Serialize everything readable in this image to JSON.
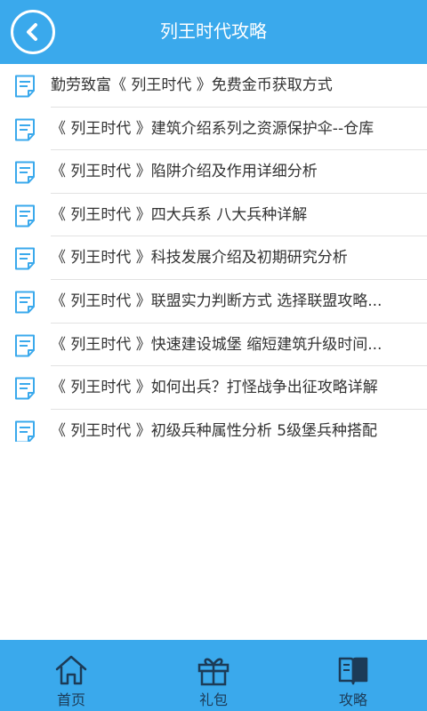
{
  "header": {
    "title": "列王时代攻略"
  },
  "articles": [
    "勤劳致富《 列王时代 》免费金币获取方式",
    "《 列王时代 》建筑介绍系列之资源保护伞--仓库",
    "《 列王时代 》陷阱介绍及作用详细分析",
    "《 列王时代 》四大兵系 八大兵种详解",
    "《 列王时代 》科技发展介绍及初期研究分析",
    "《 列王时代 》联盟实力判断方式 选择联盟攻略...",
    "《 列王时代 》快速建设城堡 缩短建筑升级时间...",
    "《 列王时代 》如何出兵？打怪战争出征攻略详解",
    "《 列王时代 》初级兵种属性分析 5级堡兵种搭配"
  ],
  "tabs": [
    {
      "label": "首页",
      "icon": "home-icon"
    },
    {
      "label": "礼包",
      "icon": "gift-icon"
    },
    {
      "label": "攻略",
      "icon": "book-icon"
    }
  ],
  "colors": {
    "primary": "#3aa9ec",
    "tab_label": "#1c3b57",
    "text": "#333333",
    "divider": "#e2e2e2"
  }
}
